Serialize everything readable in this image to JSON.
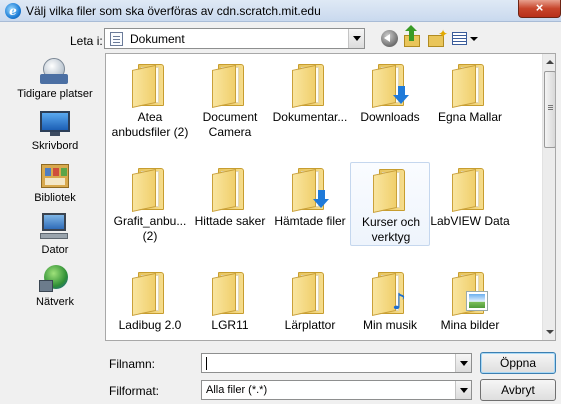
{
  "window": {
    "title": "Välj vilka filer som ska överföras av cdn.scratch.mit.edu",
    "close_label": "×"
  },
  "toolbar": {
    "look_in_label": "Leta i:",
    "look_in_value": "Dokument"
  },
  "places": [
    {
      "label": "Tidigare platser",
      "icon": "recent-places-icon"
    },
    {
      "label": "Skrivbord",
      "icon": "desktop-icon"
    },
    {
      "label": "Bibliotek",
      "icon": "libraries-icon"
    },
    {
      "label": "Dator",
      "icon": "computer-icon"
    },
    {
      "label": "Nätverk",
      "icon": "network-icon"
    }
  ],
  "items": [
    {
      "name": "Atea anbudsfiler (2)",
      "badge": "none"
    },
    {
      "name": "Document Camera",
      "badge": "none"
    },
    {
      "name": "Dokumentar...",
      "badge": "none"
    },
    {
      "name": "Downloads",
      "badge": "download"
    },
    {
      "name": "Egna Mallar",
      "badge": "none"
    },
    {
      "name": "Grafit_anbu... (2)",
      "badge": "none"
    },
    {
      "name": "Hittade saker",
      "badge": "none"
    },
    {
      "name": "Hämtade filer",
      "badge": "download"
    },
    {
      "name": "Kurser och verktyg",
      "badge": "none",
      "selected": true
    },
    {
      "name": "LabVIEW Data",
      "badge": "none"
    },
    {
      "name": "Ladibug 2.0",
      "badge": "none"
    },
    {
      "name": "LGR11",
      "badge": "none"
    },
    {
      "name": "Lärplattor",
      "badge": "none"
    },
    {
      "name": "Min musik",
      "badge": "music"
    },
    {
      "name": "Mina bilder",
      "badge": "pictures"
    }
  ],
  "footer": {
    "filename_label": "Filnamn:",
    "filename_value": "",
    "filetype_label": "Filformat:",
    "filetype_value": "Alla filer (*.*)",
    "open_label": "Öppna",
    "cancel_label": "Avbryt"
  },
  "colors": {
    "selection_border": "#c5d7ee",
    "folder": "#f0cf6c",
    "badge_blue": "#1f7ad9"
  }
}
